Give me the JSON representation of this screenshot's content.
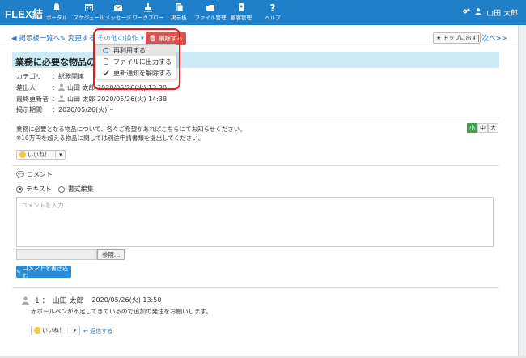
{
  "app": {
    "logo": "FLEX結"
  },
  "nav": [
    {
      "label": "ポータル",
      "icon": "bell-icon"
    },
    {
      "label": "スケジュール",
      "icon": "calendar-icon"
    },
    {
      "label": "メッセージ",
      "icon": "mail-icon"
    },
    {
      "label": "ワークフロー",
      "icon": "stamp-icon"
    },
    {
      "label": "掲示板",
      "icon": "board-icon"
    },
    {
      "label": "ファイル管理",
      "icon": "folder-icon"
    },
    {
      "label": "顧客管理",
      "icon": "customer-icon"
    },
    {
      "label": "ヘルプ",
      "icon": "help-icon"
    }
  ],
  "user": {
    "name": "山田 太郎"
  },
  "toolbar": {
    "back": "◀ 掲示板一覧へ",
    "edit": "変更する",
    "other": "その他の操作 ▾",
    "delete": "削除する",
    "to_top": "トップに出す",
    "next": "次へ>>"
  },
  "dropdown": {
    "items": [
      {
        "label": "再利用する",
        "icon": "refresh-icon",
        "active": true
      },
      {
        "label": "ファイルに出力する",
        "icon": "file-icon",
        "active": false
      },
      {
        "label": "更新通知を解除する",
        "icon": "check-icon",
        "active": false
      }
    ]
  },
  "post": {
    "title": "業務に必要な物品の募集",
    "category_label": "カテゴリ",
    "category": "：総務関連",
    "sender_label": "差出人",
    "sender": "山田 太郎 2020/05/26(火) 13:30",
    "updater_label": "最終更新者",
    "updater": "山田 太郎 2020/05/26(火) 14:38",
    "period_label": "掲示期間",
    "period": "：2020/05/26(火)～",
    "body_line1": "業務に必要となる物品について、各々ご希望があればこちらにてお知らせください。",
    "body_line2": "※10万円を超える物品に関しては別途申請書類を提出してください。"
  },
  "size_buttons": [
    "小",
    "中",
    "大"
  ],
  "like": {
    "label": "いいね！",
    "caret": "▾"
  },
  "comment_section": {
    "title": "コメント",
    "mode_text": "テキスト",
    "mode_rich": "書式編集",
    "placeholder": "コメントを入力...",
    "browse": "参照...",
    "submit": "コメントを書き込む"
  },
  "comment": {
    "number": "1 ：",
    "author": "山田 太郎",
    "date": "2020/05/26(火) 13:50",
    "text": "赤ボールペンが不足してきているので追加の発注をお願いします。",
    "reply": "返信する"
  }
}
